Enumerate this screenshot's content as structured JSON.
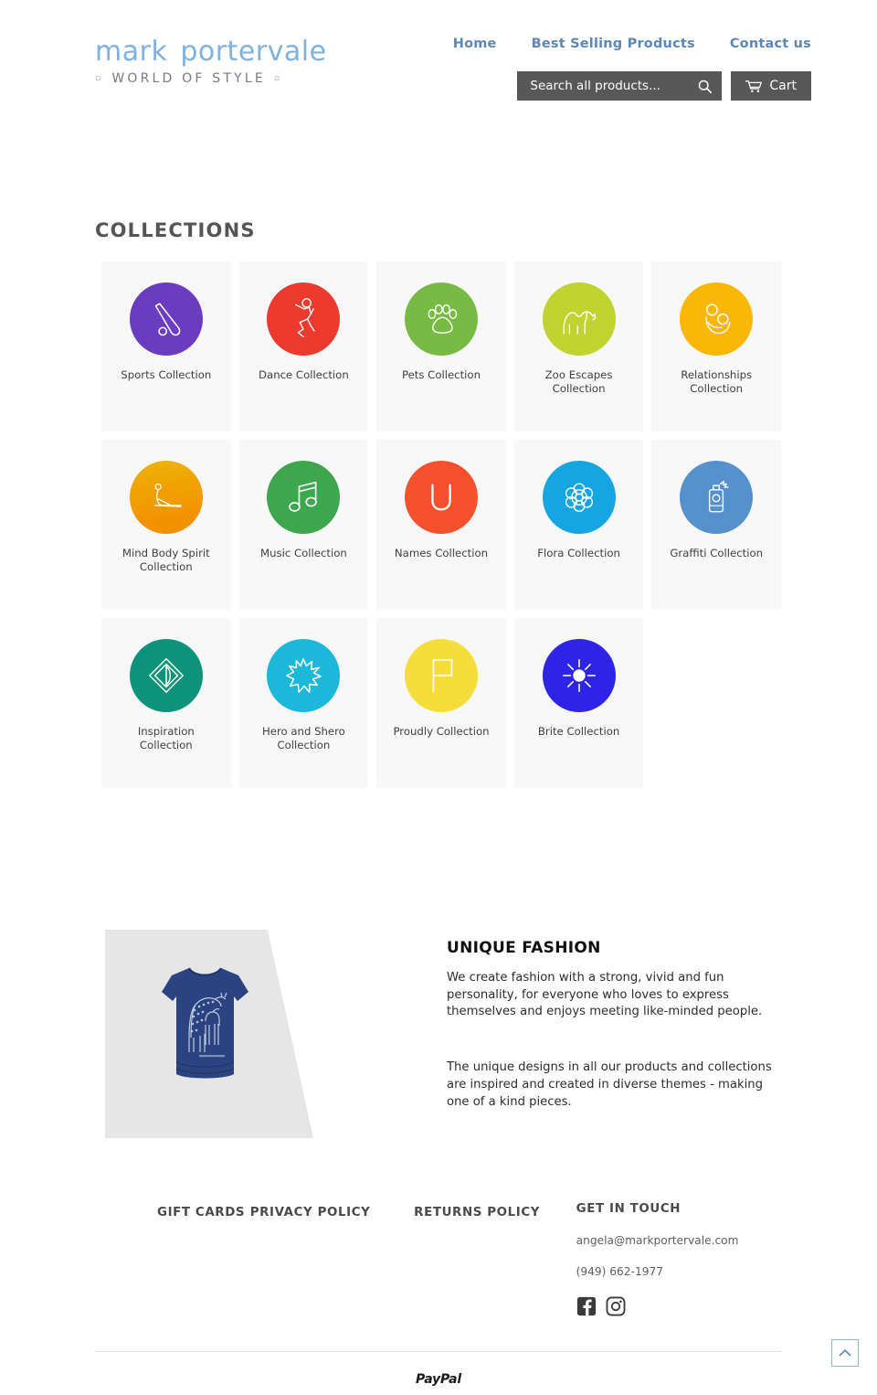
{
  "header": {
    "logo_main_1": "mark",
    "logo_main_2": "portervale",
    "logo_sub": "WORLD OF STYLE",
    "nav": [
      {
        "label": "Home",
        "name": "nav-home"
      },
      {
        "label": "Best Selling Products",
        "name": "nav-best-selling-products"
      },
      {
        "label": "Contact us",
        "name": "nav-contact-us"
      }
    ],
    "search_placeholder": "Search all products...",
    "search_value": "",
    "cart_label": "Cart"
  },
  "collections": {
    "title": "COLLECTIONS",
    "items": [
      {
        "label": "Sports Collection",
        "color": "#6b3cc0",
        "icon": "baseball-bat-icon"
      },
      {
        "label": "Dance Collection",
        "color": "#ed3a2f",
        "icon": "dancer-icon"
      },
      {
        "label": "Pets Collection",
        "color": "#77bb44",
        "icon": "paw-print-icon"
      },
      {
        "label": "Zoo Escapes Collection",
        "color": "#c0d330",
        "icon": "camel-icon"
      },
      {
        "label": "Relationships Collection",
        "color": "#fbb707",
        "icon": "mother-child-icon"
      },
      {
        "label": "Mind Body Spirit Collection",
        "color": "#f39200",
        "icon": "yoga-pose-icon"
      },
      {
        "label": "Music Collection",
        "color": "#3da74e",
        "icon": "music-note-icon"
      },
      {
        "label": "Names Collection",
        "color": "#f4512c",
        "icon": "letter-u-icon"
      },
      {
        "label": "Flora Collection",
        "color": "#16a5e3",
        "icon": "flower-icon"
      },
      {
        "label": "Graffiti Collection",
        "color": "#5591cc",
        "icon": "spray-can-icon"
      },
      {
        "label": "Inspiration Collection",
        "color": "#0c9379",
        "icon": "diamond-icon"
      },
      {
        "label": "Hero and Shero Collection",
        "color": "#1cb8d9",
        "icon": "starburst-icon"
      },
      {
        "label": "Proudly Collection",
        "color": "#f5dd3c",
        "icon": "flag-icon"
      },
      {
        "label": "Brite Collection",
        "color": "#2e24e8",
        "icon": "sun-icon"
      }
    ]
  },
  "about": {
    "image_alt": "navy-giraffe-tshirt",
    "title": "UNIQUE FASHION",
    "paragraph1": "We create fashion with a strong, vivid and fun personality, for everyone who loves to express themselves and enjoys meeting like-minded people.",
    "paragraph2": "The unique designs in all our products and collections are inspired and created in diverse themes - making one of a kind pieces."
  },
  "footer": {
    "col1_title": "GIFT CARDS",
    "col2_title": "PRIVACY POLICY",
    "col3_title": "RETURNS POLICY",
    "col4_title": "GET IN TOUCH",
    "email": "angela@markportervale.com",
    "phone": "(949) 662-1977",
    "social": [
      {
        "name": "facebook-icon",
        "label": "Facebook"
      },
      {
        "name": "instagram-icon",
        "label": "Instagram"
      }
    ],
    "payment": "PayPal"
  },
  "back_to_top": {
    "name": "back-to-top-button",
    "glyph": "chevron-up-icon"
  }
}
